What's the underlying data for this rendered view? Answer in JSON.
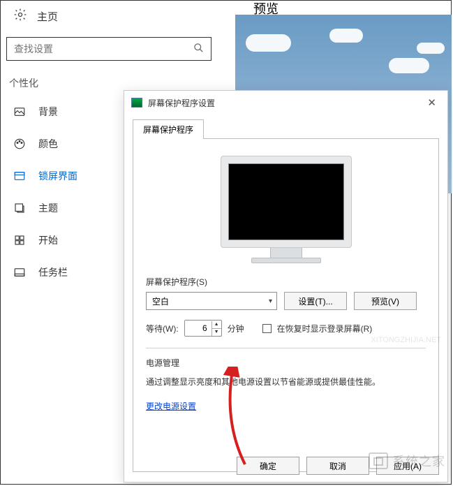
{
  "header": {
    "home_label": "主页",
    "preview_title": "预览"
  },
  "search": {
    "placeholder": "查找设置"
  },
  "category": "个性化",
  "nav": {
    "background": "背景",
    "colors": "颜色",
    "lockscreen": "锁屏界面",
    "themes": "主题",
    "start": "开始",
    "taskbar": "任务栏"
  },
  "dialog": {
    "title": "屏幕保护程序设置",
    "tab": "屏幕保护程序",
    "screensaver_label": "屏幕保护程序(S)",
    "screensaver_value": "空白",
    "settings_btn": "设置(T)...",
    "preview_btn": "预览(V)",
    "wait_label": "等待(W):",
    "wait_value": "6",
    "wait_unit": "分钟",
    "resume_checkbox": "在恢复时显示登录屏幕(R)",
    "power_section": "电源管理",
    "power_desc": "通过调整显示亮度和其他电源设置以节省能源或提供最佳性能。",
    "power_link": "更改电源设置",
    "ok_btn": "确定",
    "cancel_btn": "取消",
    "apply_btn": "应用(A)"
  },
  "watermark": "系统之家"
}
